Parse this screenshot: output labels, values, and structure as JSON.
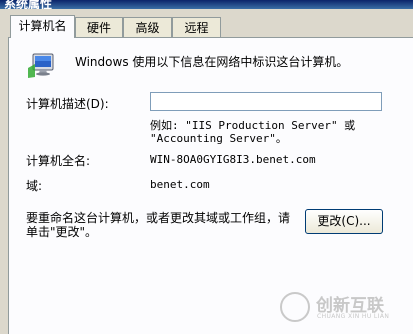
{
  "window": {
    "title": "系统属性"
  },
  "tabs": [
    {
      "label": "计算机名"
    },
    {
      "label": "硬件"
    },
    {
      "label": "高级"
    },
    {
      "label": "远程"
    }
  ],
  "intro": "Windows 使用以下信息在网络中标识这台计算机。",
  "description": {
    "label": "计算机描述(D):",
    "value": "",
    "example_line1": "例如: \"IIS Production Server\" 或",
    "example_line2": "\"Accounting Server\"。"
  },
  "full_name": {
    "label": "计算机全名:",
    "value": "WIN-8OA0GYIG8I3.benet.com"
  },
  "domain": {
    "label": "域:",
    "value": "benet.com"
  },
  "rename": {
    "text_line1": "要重命名这台计算机，或者更改其域或工作组，请",
    "text_line2": "单击\"更改\"。",
    "button_label": "更改(C)..."
  },
  "watermark": {
    "title": "创新互联",
    "subtitle": "CHUANG XIN HU LIAN"
  },
  "icons": {
    "computer": "computer-monitor-icon",
    "watermark": "brand-logo-icon"
  }
}
